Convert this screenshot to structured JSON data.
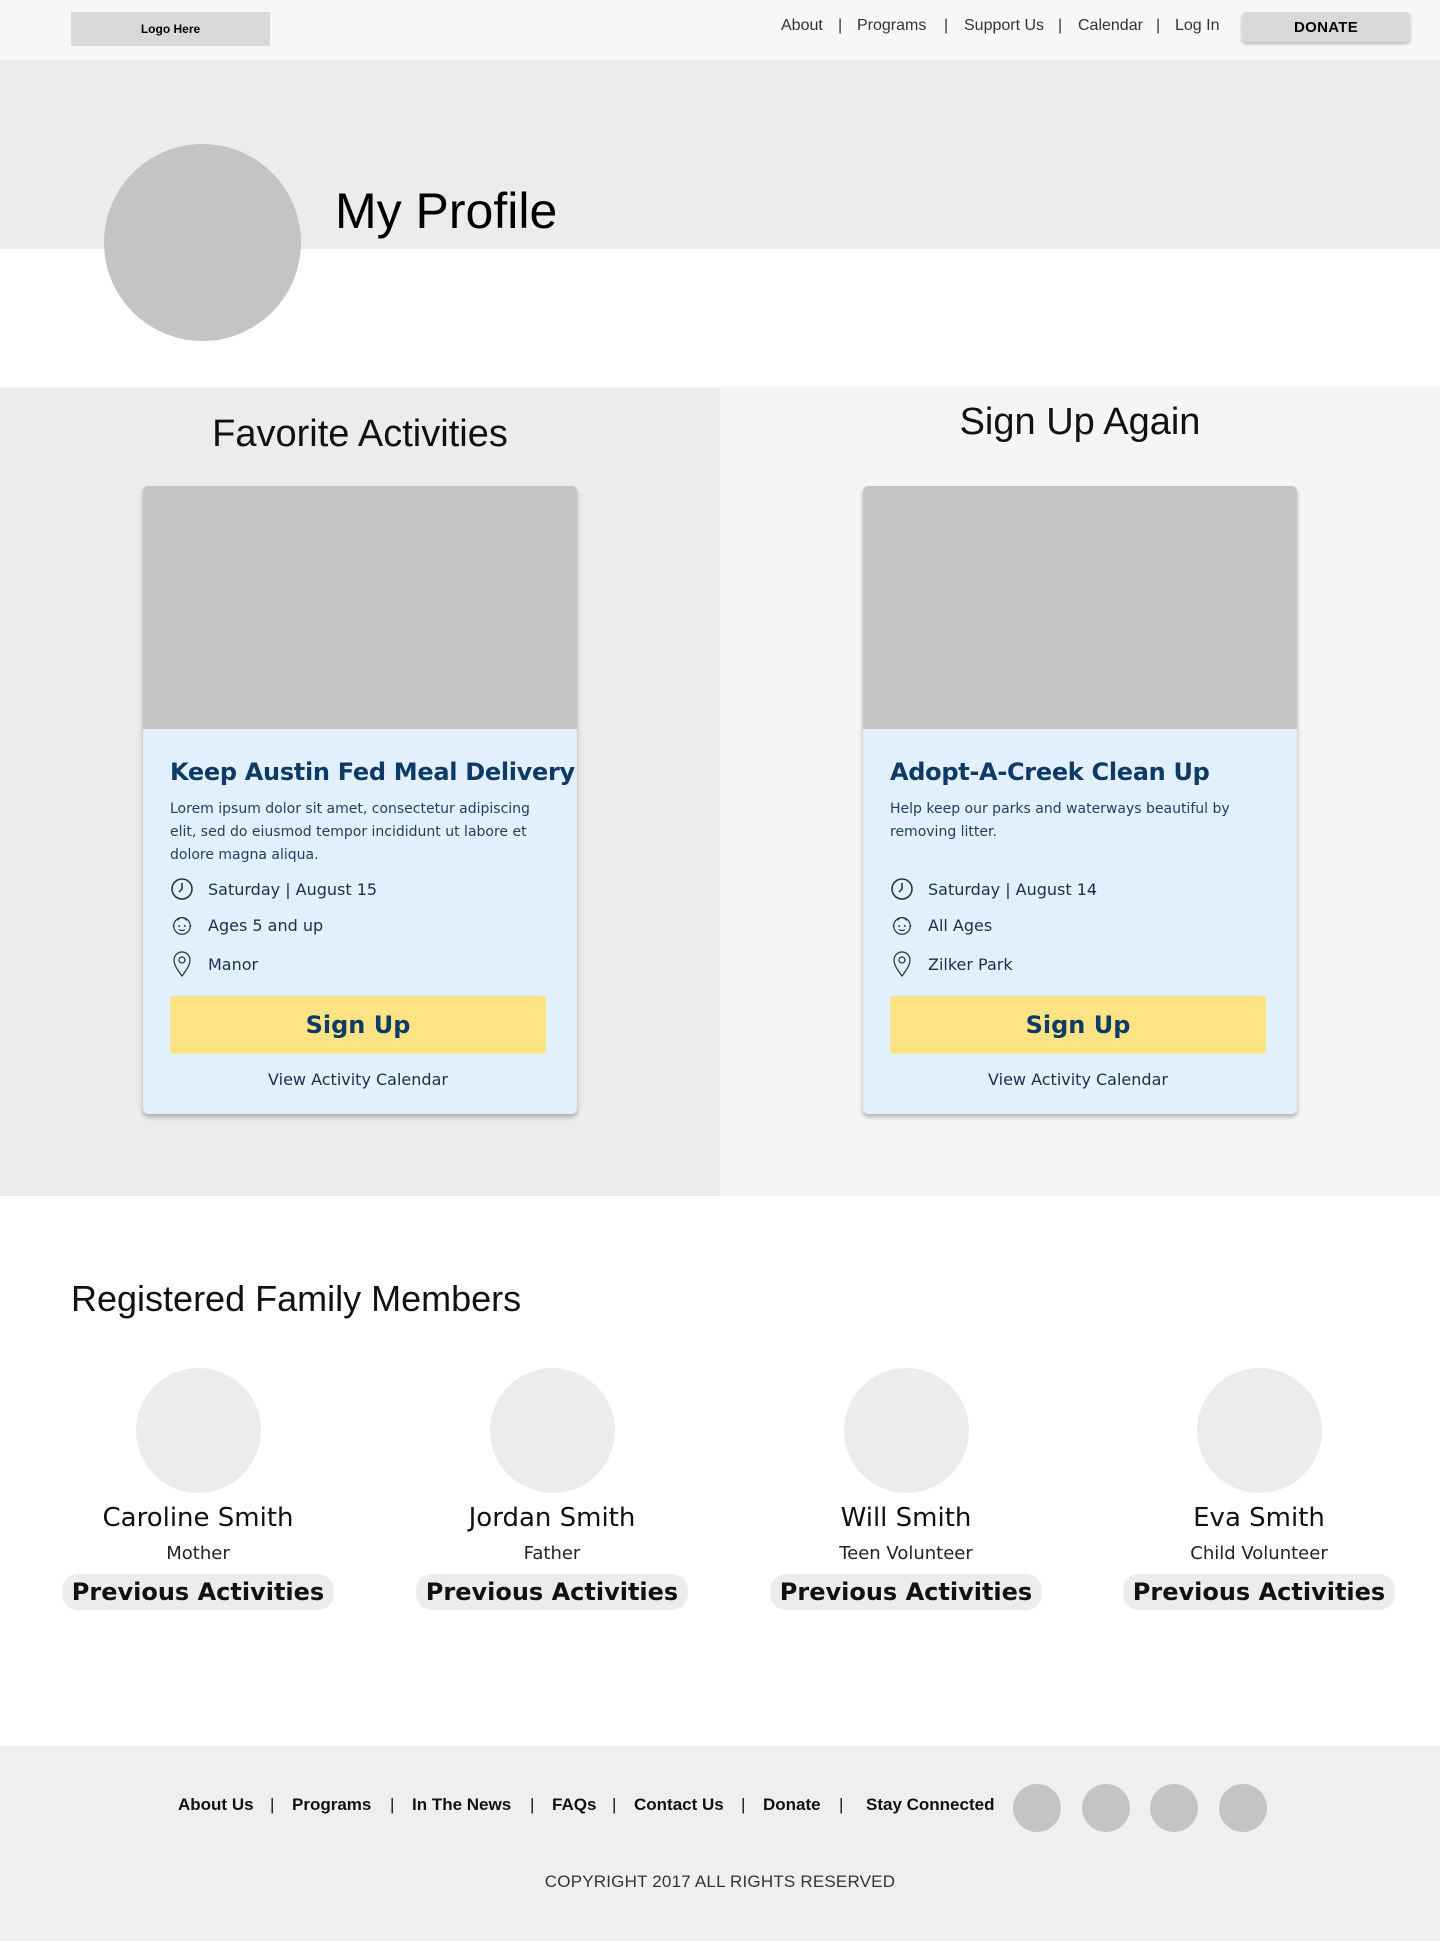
{
  "header": {
    "logo": "Logo Here",
    "nav": [
      "About",
      "Programs",
      "Support Us",
      "Calendar",
      "Log In"
    ],
    "separator": "|",
    "donate": "DONATE"
  },
  "profile": {
    "title": "My Profile"
  },
  "favorites": {
    "title": "Favorite Activities",
    "card": {
      "title": "Keep Austin Fed Meal Delivery",
      "description": "Lorem ipsum dolor sit amet, consectetur adipiscing elit, sed do eiusmod tempor incididunt ut labore et dolore magna aliqua.",
      "date": "Saturday  |  August 15",
      "ages": "Ages 5 and up",
      "location": "Manor",
      "signup": "Sign Up",
      "calendar_link": "View Activity Calendar"
    }
  },
  "signup_again": {
    "title": "Sign Up Again",
    "card": {
      "title": "Adopt-A-Creek Clean Up",
      "description": "Help keep our parks and waterways beautiful by removing litter.",
      "date": "Saturday  |  August 14",
      "ages": "All Ages",
      "location": "Zilker Park",
      "signup": "Sign Up",
      "calendar_link": "View Activity Calendar"
    }
  },
  "family": {
    "title": "Registered Family Members",
    "members": [
      {
        "name": "Caroline Smith",
        "role": "Mother",
        "button": "Previous Activities"
      },
      {
        "name": "Jordan Smith",
        "role": "Father",
        "button": "Previous Activities"
      },
      {
        "name": "Will Smith",
        "role": "Teen Volunteer",
        "button": "Previous Activities"
      },
      {
        "name": "Eva Smith",
        "role": "Child Volunteer",
        "button": "Previous Activities"
      }
    ]
  },
  "footer": {
    "links": [
      "About Us",
      "Programs",
      "In The News",
      "FAQs",
      "Contact Us",
      "Donate"
    ],
    "separator": "|",
    "stay_connected": "Stay Connected",
    "copyright": "COPYRIGHT 2017 ALL RIGHTS RESERVED"
  },
  "colors": {
    "card_bg": "#e2effc",
    "title_blue": "#0d3b66",
    "button_yellow": "#fde384"
  }
}
